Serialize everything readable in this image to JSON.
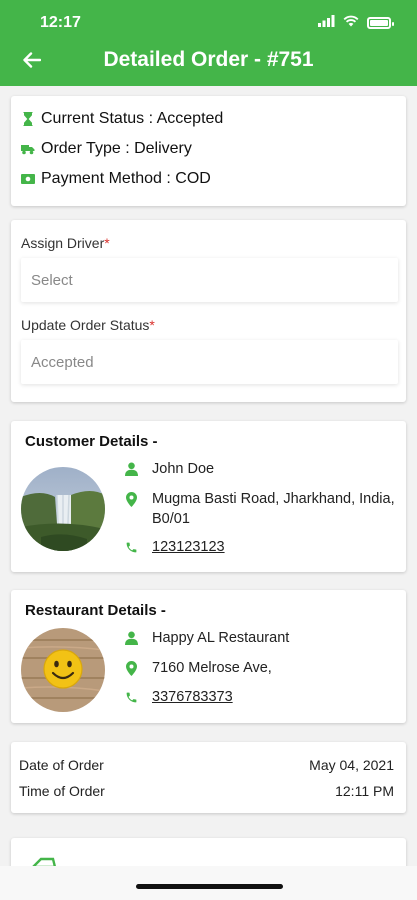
{
  "status_bar": {
    "time": "12:17"
  },
  "header": {
    "title": "Detailed Order - #751"
  },
  "order_summary": {
    "status": "Current Status : Accepted",
    "order_type": "Order Type : Delivery",
    "payment_method": "Payment Method : COD"
  },
  "assign": {
    "driver_label": "Assign Driver",
    "driver_value": "Select",
    "status_label": "Update Order Status",
    "status_value": "Accepted",
    "required_mark": "*"
  },
  "customer": {
    "title": "Customer Details -",
    "name": "John Doe",
    "address": "Mugma Basti Road, Jharkhand, India, B0/01",
    "phone": "123123123"
  },
  "restaurant": {
    "title": "Restaurant Details -",
    "name": "Happy AL Restaurant",
    "address": "7160 Melrose Ave,",
    "phone": "3376783373"
  },
  "datetime": {
    "date_label": "Date of Order",
    "date_value": "May 04, 2021",
    "time_label": "Time of Order",
    "time_value": "12:11 PM"
  },
  "colors": {
    "accent": "#44b549",
    "required": "#d9302b"
  }
}
